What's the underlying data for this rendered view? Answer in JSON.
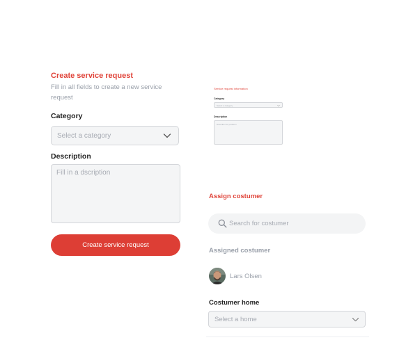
{
  "create_form": {
    "title": "Create service request",
    "subtitle": "Fill in all fields to create a new service request",
    "category_label": "Category",
    "category_placeholder": "Select a category",
    "description_label": "Description",
    "description_placeholder": "Fill in a dscription",
    "submit_label": "Create service request"
  },
  "preview": {
    "title": "Service request information",
    "category_label": "Category",
    "category_placeholder": "Select a category",
    "description_label": "Description",
    "description_placeholder": "Describe the problem"
  },
  "assign": {
    "title": "Assign costumer",
    "search_placeholder": "Search for costumer",
    "assigned_label": "Assigned costumer",
    "assigned_name": "Lars Olsen",
    "home_label": "Costumer home",
    "home_placeholder": "Select a home"
  },
  "colors": {
    "accent": "#dd3e35",
    "muted_text": "#a7abb3",
    "field_bg": "#f4f5f6"
  },
  "icons": [
    "chevron-down-icon",
    "search-icon",
    "avatar"
  ]
}
